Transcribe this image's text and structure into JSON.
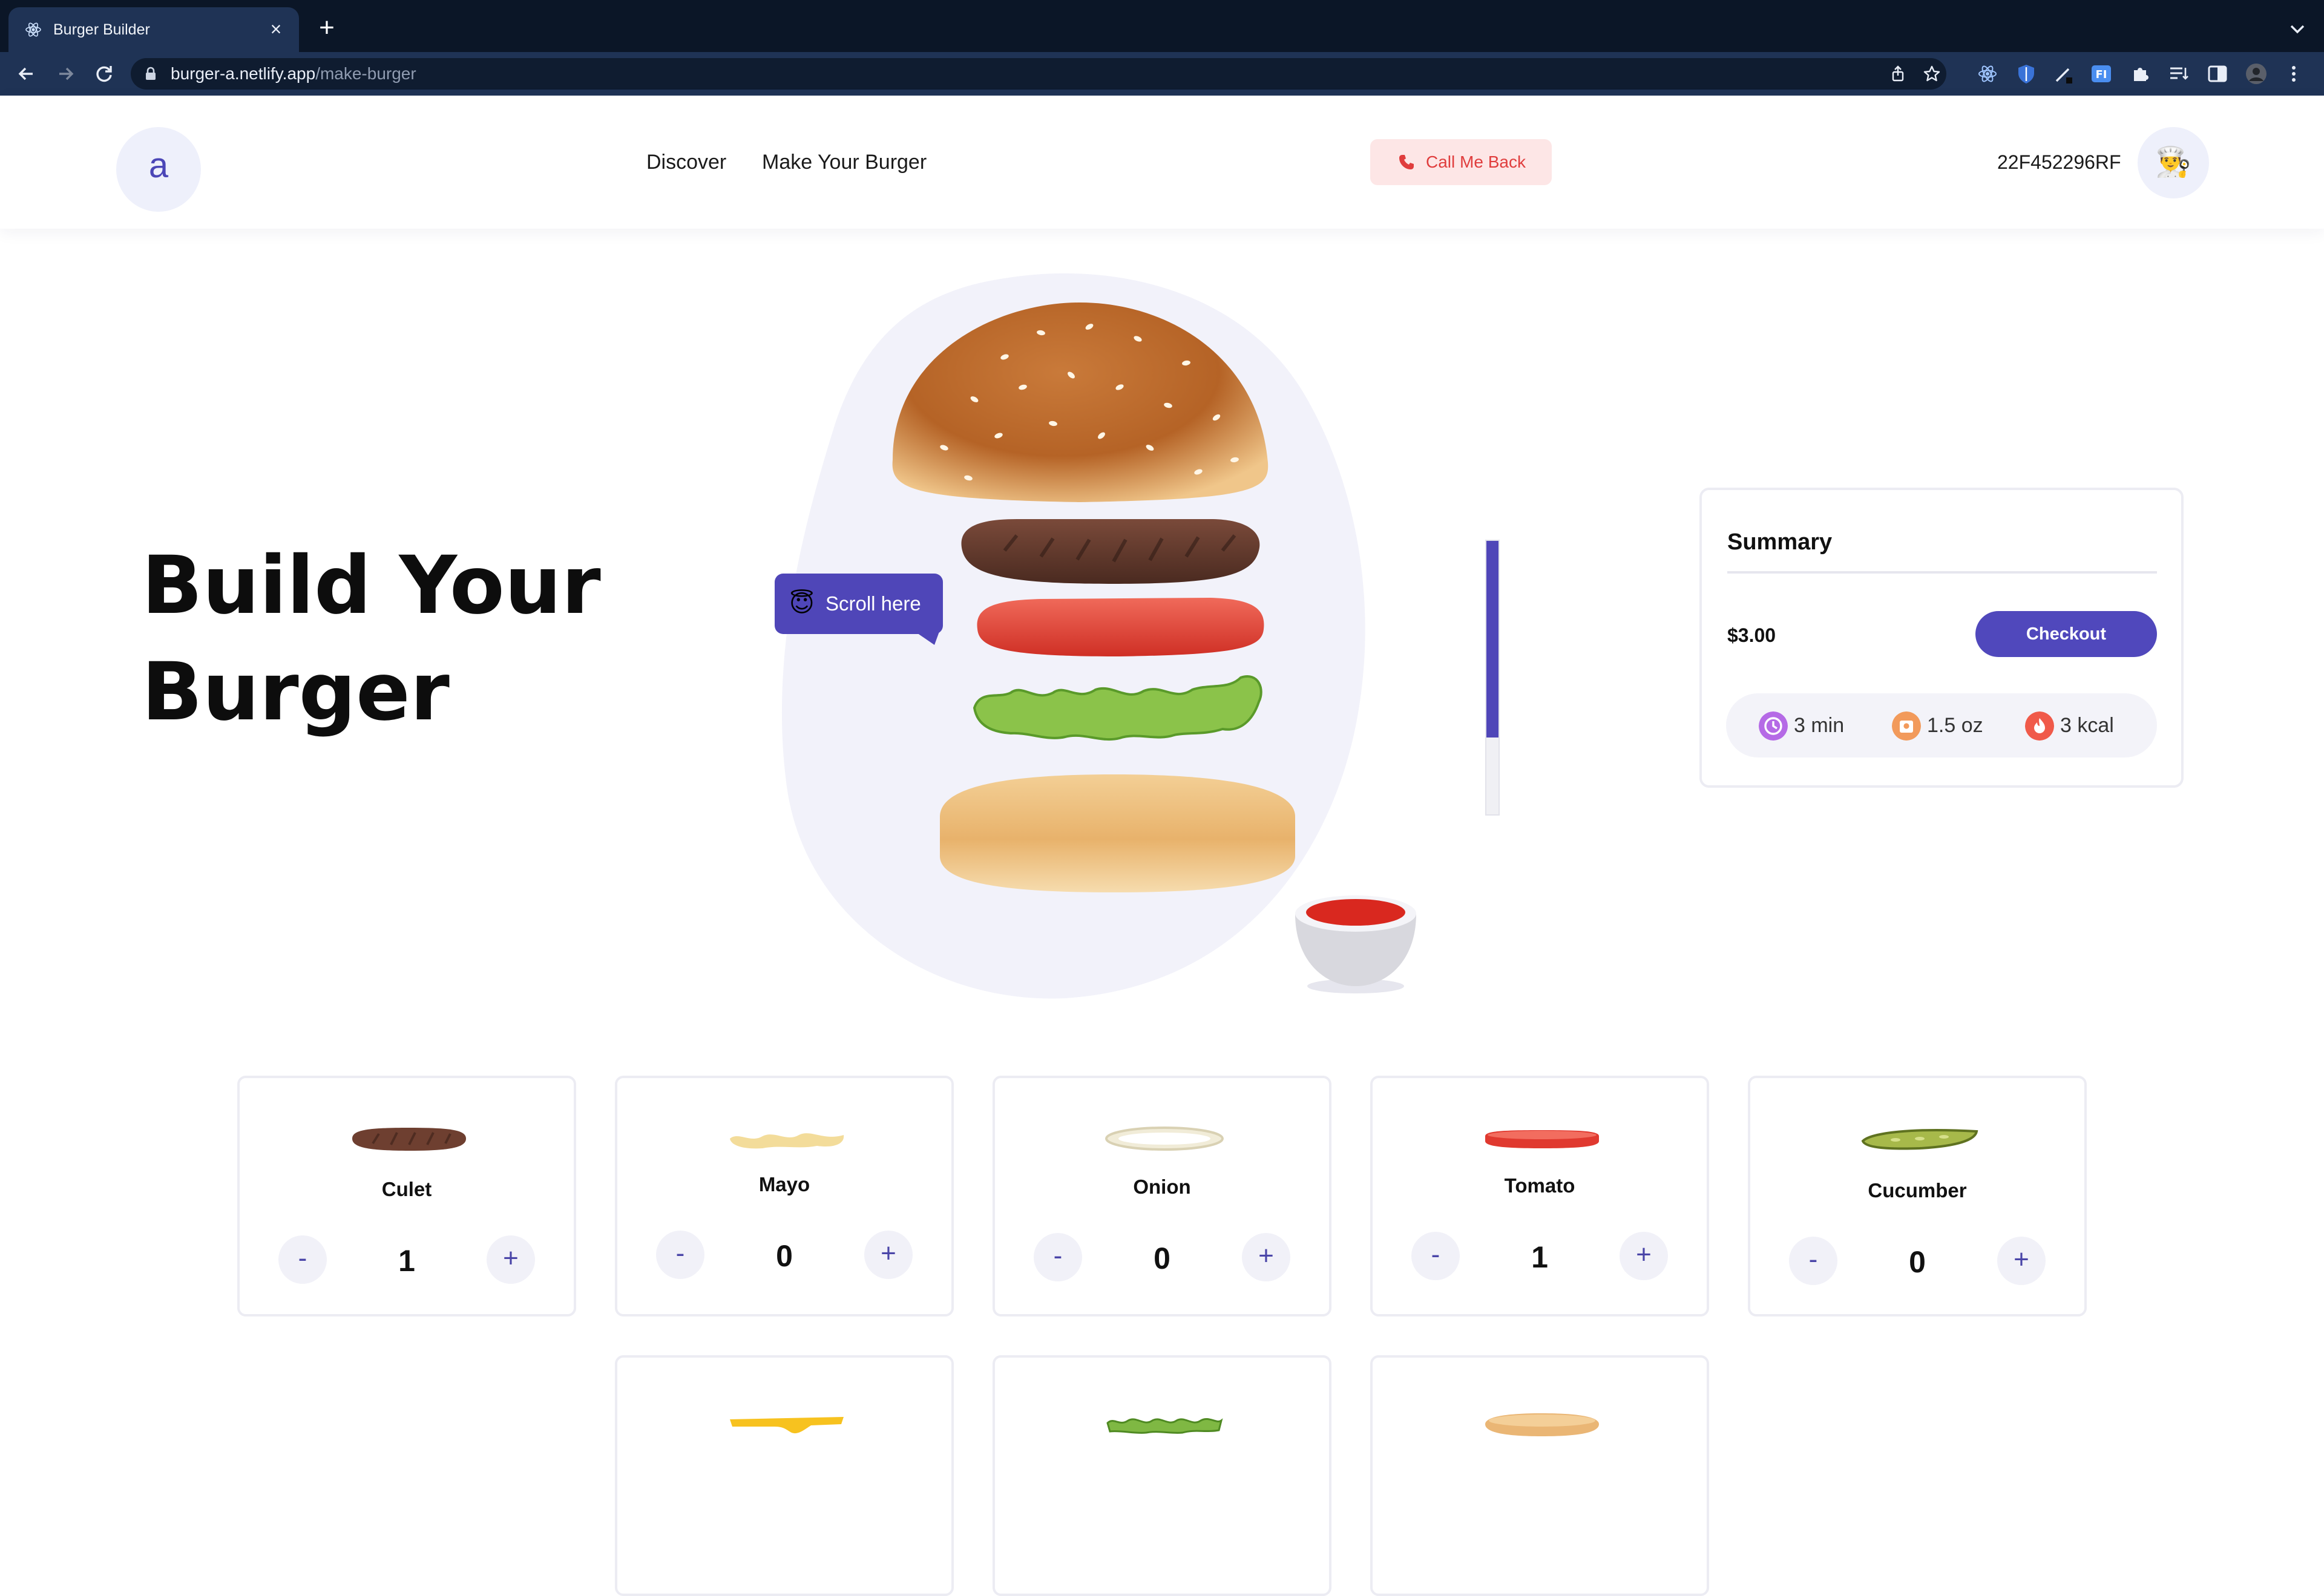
{
  "browser": {
    "tab_title": "Burger Builder",
    "url_host": "burger-a.netlify.app",
    "url_path": "/make-burger"
  },
  "header": {
    "logo_letter": "a",
    "nav": [
      "Discover",
      "Make Your Burger"
    ],
    "callback_label": "Call Me Back",
    "order_id": "22F452296RF",
    "avatar_emoji": "👨‍🍳"
  },
  "hero": {
    "title_line1": "Build Your",
    "title_line2": "Burger",
    "scroll_tip": "Scroll here",
    "scroll_tip_emoji": "😇",
    "scroll_progress": 0.72
  },
  "summary": {
    "title": "Summary",
    "price": "$3.00",
    "checkout_label": "Checkout",
    "stats": [
      {
        "icon": "clock-icon",
        "value": "3 min",
        "color": "#b56ae6"
      },
      {
        "icon": "weight-icon",
        "value": "1.5 oz",
        "color": "#f29a5b"
      },
      {
        "icon": "flame-icon",
        "value": "3 kcal",
        "color": "#f05a4a"
      }
    ]
  },
  "ingredients": [
    {
      "name": "Culet",
      "count": "1"
    },
    {
      "name": "Mayo",
      "count": "0"
    },
    {
      "name": "Onion",
      "count": "0"
    },
    {
      "name": "Tomato",
      "count": "1"
    },
    {
      "name": "Cucumber",
      "count": "0"
    },
    {
      "name": "",
      "count": ""
    },
    {
      "name": "",
      "count": ""
    },
    {
      "name": "",
      "count": ""
    }
  ],
  "controls": {
    "minus": "-",
    "plus": "+"
  },
  "colors": {
    "accent": "#5048bc",
    "callback_bg": "#fde6e6",
    "callback_text": "#e03d3d"
  }
}
